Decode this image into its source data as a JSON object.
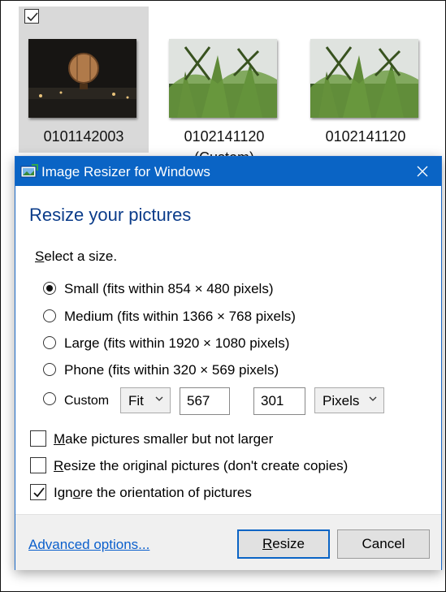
{
  "explorer": {
    "thumbnails": [
      {
        "name": "0101142003",
        "selected": true,
        "checked": true
      },
      {
        "name": "0102141120",
        "sub": "(Custom)"
      },
      {
        "name": "0102141120"
      }
    ]
  },
  "dialog": {
    "title": "Image Resizer for Windows",
    "heading": "Resize your pictures",
    "select_label": {
      "key": "S",
      "rest": "elect a size."
    },
    "sizes": [
      {
        "label": "Small (fits within 854 × 480 pixels)",
        "checked": true
      },
      {
        "label": "Medium (fits within 1366 × 768 pixels)",
        "checked": false
      },
      {
        "label": "Large (fits within 1920 × 1080 pixels)",
        "checked": false
      },
      {
        "label": "Phone (fits within 320 × 569 pixels)",
        "checked": false
      }
    ],
    "custom": {
      "label": "Custom",
      "fit_value": "Fit",
      "width": "567",
      "times": "×",
      "height": "301",
      "unit_value": "Pixels"
    },
    "options": [
      {
        "key": "M",
        "rest": "ake pictures smaller but not larger",
        "checked": false
      },
      {
        "key": "R",
        "rest": "esize the original pictures (don't create copies)",
        "checked": false
      },
      {
        "pre": "Ign",
        "key": "o",
        "rest": "re the orientation of pictures",
        "checked": true
      }
    ],
    "footer": {
      "advanced_link": "Advanced options...",
      "resize_key": "R",
      "resize_rest": "esize",
      "cancel_label": "Cancel"
    }
  },
  "colors": {
    "titlebar": "#0a64c5",
    "heading": "#0b3c8a",
    "link": "#0b5fcc"
  }
}
